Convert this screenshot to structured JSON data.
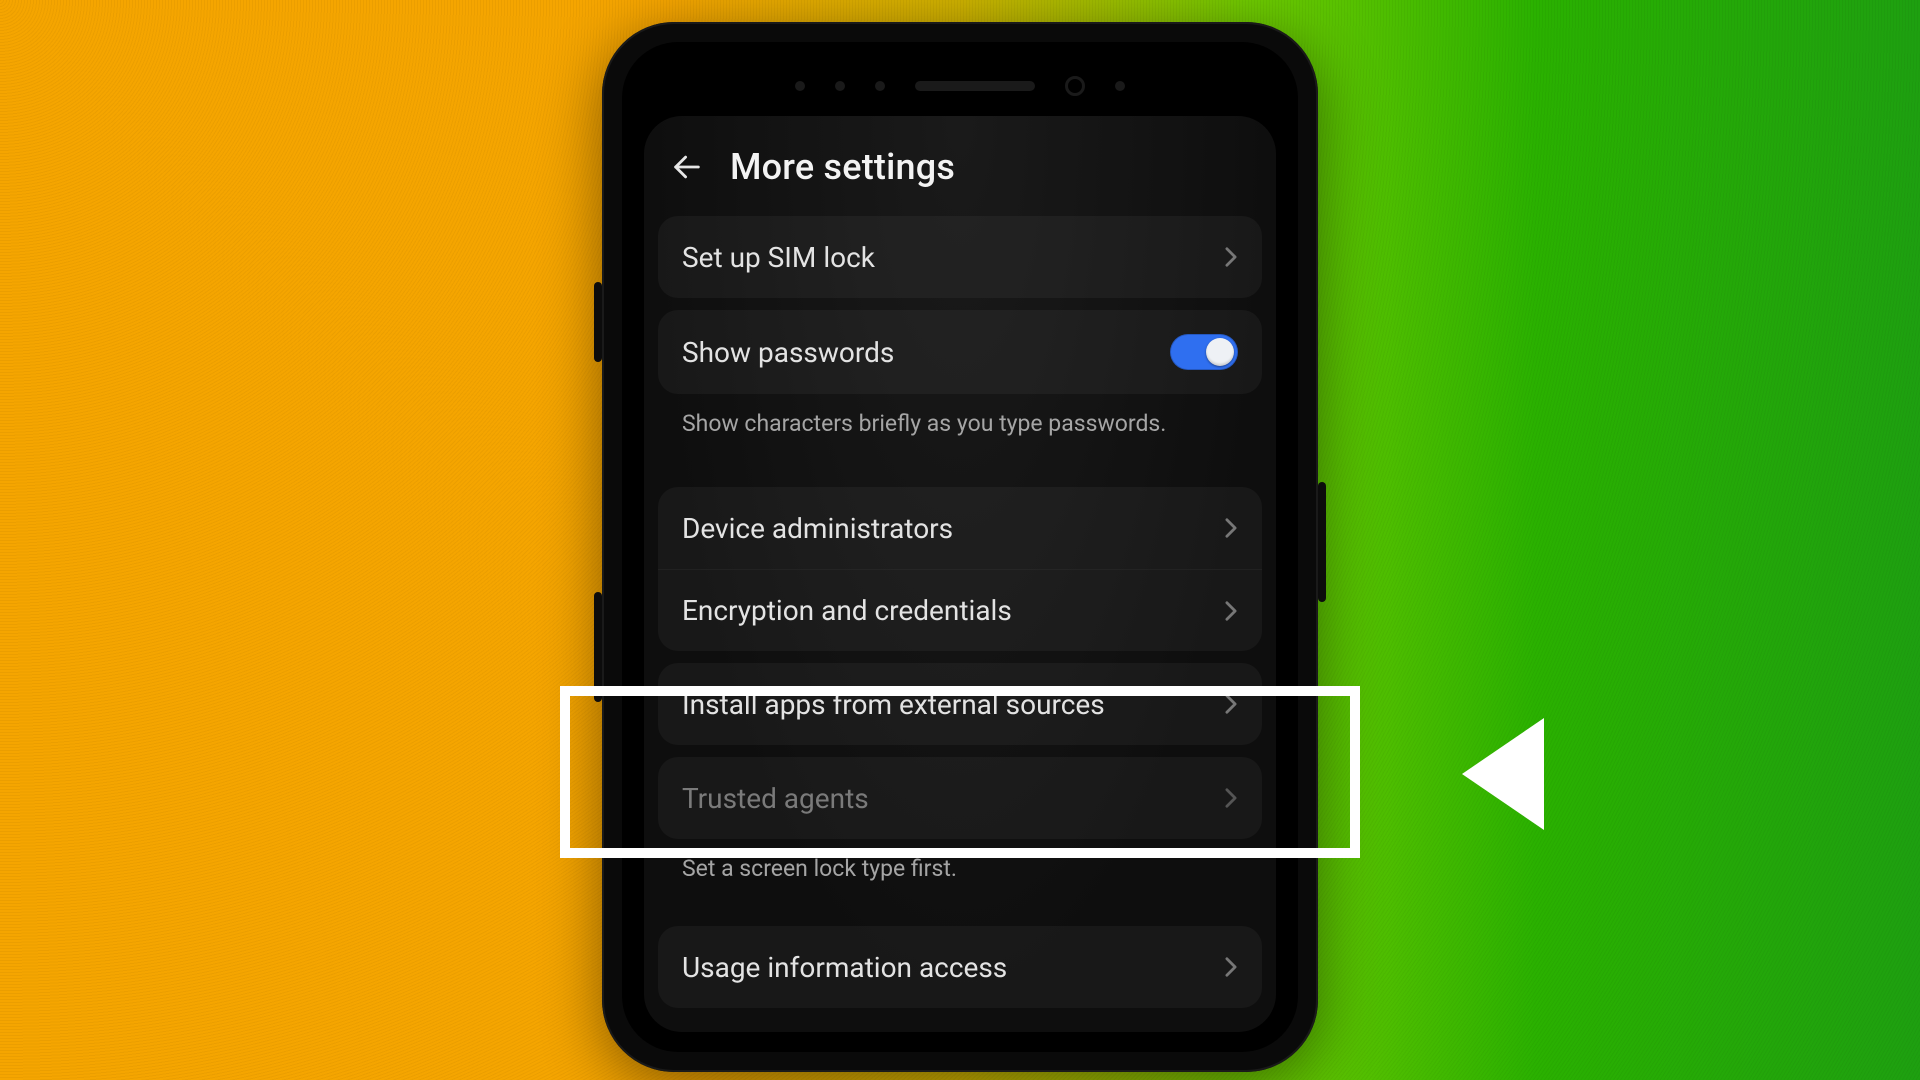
{
  "header": {
    "title": "More settings"
  },
  "items": {
    "sim_lock": {
      "label": "Set up SIM lock"
    },
    "show_passwords": {
      "label": "Show passwords",
      "caption": "Show characters briefly as you type passwords.",
      "toggle_on": true
    },
    "device_admins": {
      "label": "Device administrators"
    },
    "encryption": {
      "label": "Encryption and credentials"
    },
    "external_sources": {
      "label": "Install apps from external sources"
    },
    "trusted_agents": {
      "label": "Trusted agents",
      "caption": "Set a screen lock type first."
    },
    "usage_info": {
      "label": "Usage information access"
    }
  }
}
